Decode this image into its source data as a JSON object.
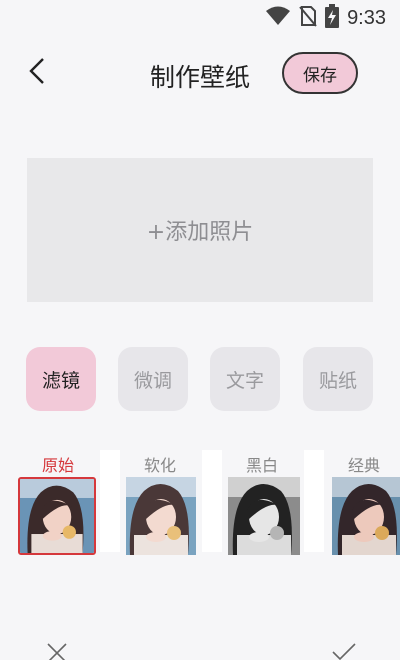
{
  "status_bar": {
    "time": "9:33",
    "icons": [
      "wifi-icon",
      "no-sim-icon",
      "battery-charging-icon"
    ]
  },
  "header": {
    "back_icon": "chevron-left-icon",
    "title": "制作壁纸",
    "save_label": "保存"
  },
  "photo_area": {
    "label": "+添加照片"
  },
  "tabs": [
    {
      "label": "滤镜",
      "active": true
    },
    {
      "label": "微调",
      "active": false
    },
    {
      "label": "文字",
      "active": false
    },
    {
      "label": "贴纸",
      "active": false
    }
  ],
  "filters": [
    {
      "label": "原始",
      "selected": true,
      "style": "color"
    },
    {
      "label": "软化",
      "selected": false,
      "style": "soft"
    },
    {
      "label": "黑白",
      "selected": false,
      "style": "bw"
    },
    {
      "label": "经典",
      "selected": false,
      "style": "classic"
    }
  ],
  "bottom_bar": {
    "cancel_icon": "close-icon",
    "confirm_icon": "check-icon"
  },
  "colors": {
    "accent_pink": "#f2c9d8",
    "selected_red": "#d5383c",
    "inactive_tab": "#e7e6ea",
    "photo_placeholder": "#e8e8ea"
  }
}
